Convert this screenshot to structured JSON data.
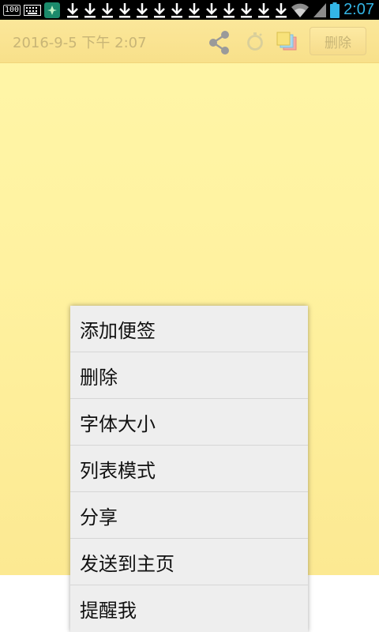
{
  "status_bar": {
    "battery_small": "100",
    "time": "2:07",
    "download_count": 13,
    "colors": {
      "time": "#33b5e5",
      "battery": "#33b5e5"
    }
  },
  "note": {
    "date": "2016-9-5 下午 2:07",
    "delete_label": "删除",
    "icons": [
      "share-icon",
      "alarm-icon",
      "background-color-icon"
    ]
  },
  "menu": {
    "items": [
      {
        "label": "添加便签"
      },
      {
        "label": "删除"
      },
      {
        "label": "字体大小"
      },
      {
        "label": "列表模式"
      },
      {
        "label": "分享"
      },
      {
        "label": "发送到主页"
      },
      {
        "label": "提醒我"
      }
    ]
  }
}
